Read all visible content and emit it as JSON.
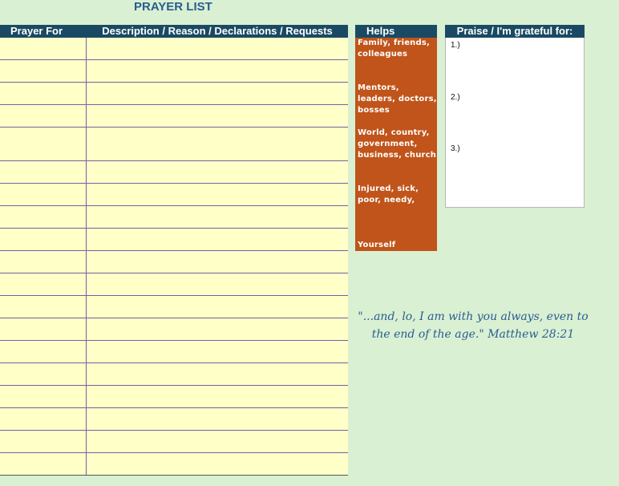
{
  "title": "PRAYER LIST",
  "table": {
    "col1_header": "Prayer For",
    "col2_header": "Description / Reason / Declarations / Requests",
    "row_count": 19
  },
  "helps": {
    "header": "Helps",
    "items": [
      {
        "label": "Family, friends, colleagues"
      },
      {
        "label": "Mentors, leaders, doctors, bosses"
      },
      {
        "label": "World, country, government, business, church"
      },
      {
        "label": "Injured, sick, poor, needy,"
      },
      {
        "label": "Yourself"
      }
    ]
  },
  "praise": {
    "header": "Praise / I'm grateful for:",
    "items": [
      "1.)",
      "2.)",
      "3.)"
    ]
  },
  "verse": "\"...and, lo, I am with you always, even to the end of the age.\" Matthew 28:21",
  "colors": {
    "background": "#d9f0d3",
    "header": "#1a4a63",
    "row_fill": "#ffffc8",
    "helps_fill": "#c0541a",
    "title": "#2a5d8f"
  }
}
